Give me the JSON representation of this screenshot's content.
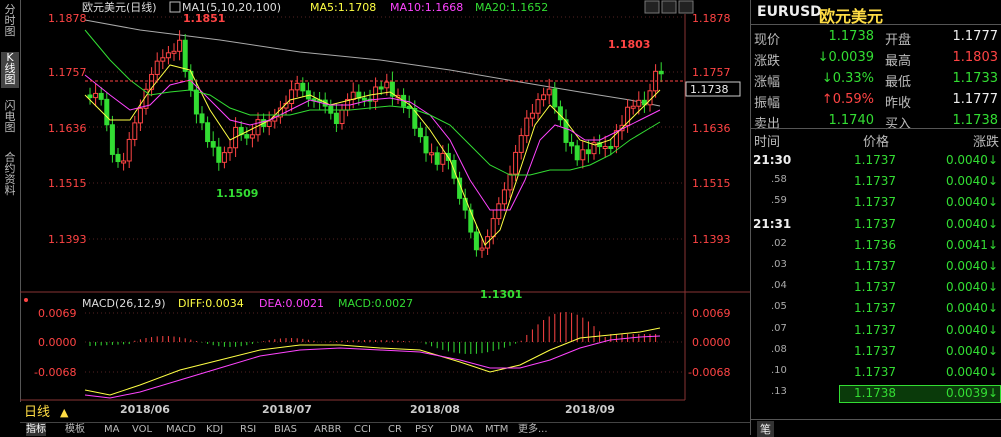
{
  "sidebar": {
    "items": [
      {
        "label": "分\n时\n图",
        "active": false
      },
      {
        "label": "K\n线\n图",
        "active": true
      },
      {
        "label": "闪\n电\n图",
        "active": false
      },
      {
        "label": "合\n约\n资\n料",
        "active": false
      }
    ]
  },
  "header": {
    "title": "欧元美元(日线)",
    "ma_label": "MA1(5,10,20,100)",
    "ma5": "MA5:1.1708",
    "ma10": "MA10:1.1668",
    "ma20": "MA20:1.1652",
    "nav_left": "◀",
    "nav_right": "▶"
  },
  "price_axis": {
    "ticks": [
      "1.1878",
      "1.1757",
      "1.1636",
      "1.1515",
      "1.1393"
    ],
    "current": "1.1738"
  },
  "annotations": {
    "high_left": "1.1851",
    "low_left": "1.1509",
    "low_mid": "1.1301",
    "high_right": "1.1803"
  },
  "macd": {
    "label": "MACD(26,12,9)",
    "diff": "DIFF:0.0034",
    "dea": "DEA:0.0021",
    "macd": "MACD:0.0027",
    "ticks": [
      "0.0069",
      "0.0000",
      "-0.0068"
    ]
  },
  "x_axis": {
    "labels": [
      "2018/06",
      "2018/07",
      "2018/08",
      "2018/09"
    ]
  },
  "period": {
    "label": "日线",
    "arrow": "▲"
  },
  "bottom_tabs": [
    "指标",
    "模板",
    "MA",
    "VOL",
    "MACD",
    "KDJ",
    "RSI",
    "BIAS",
    "ARBR",
    "CCI",
    "CR",
    "PSY",
    "DMA",
    "MTM",
    "更多..."
  ],
  "right_panel": {
    "symbol": "EURUSD",
    "name": "欧元美元",
    "quote": [
      {
        "l1": "现价",
        "v1": "1.1738",
        "c1": "#33dd33",
        "l2": "开盘",
        "v2": "1.1777",
        "c2": "#eeeeee"
      },
      {
        "l1": "涨跌",
        "v1": "↓0.0039",
        "c1": "#33dd33",
        "l2": "最高",
        "v2": "1.1803",
        "c2": "#ff4444"
      },
      {
        "l1": "涨幅",
        "v1": "↓0.33%",
        "c1": "#33dd33",
        "l2": "最低",
        "v2": "1.1733",
        "c2": "#33dd33"
      },
      {
        "l1": "振幅",
        "v1": "↑0.59%",
        "c1": "#ff4444",
        "l2": "昨收",
        "v2": "1.1777",
        "c2": "#eeeeee"
      },
      {
        "l1": "卖出",
        "v1": "1.1740",
        "c1": "#33dd33",
        "l2": "买入",
        "v2": "1.1738",
        "c2": "#33dd33"
      }
    ],
    "ticks_header": {
      "time": "时间",
      "price": "价格",
      "change": "涨跌"
    },
    "ticks": [
      {
        "time": "21:30",
        "price": "1.1737",
        "change": "0.0040↓",
        "major": true
      },
      {
        "time": ".58",
        "price": "1.1737",
        "change": "0.0040↓",
        "major": false
      },
      {
        "time": ".59",
        "price": "1.1737",
        "change": "0.0040↓",
        "major": false
      },
      {
        "time": "21:31",
        "price": "1.1737",
        "change": "0.0040↓",
        "major": true
      },
      {
        "time": ".02",
        "price": "1.1736",
        "change": "0.0041↓",
        "major": false
      },
      {
        "time": ".03",
        "price": "1.1737",
        "change": "0.0040↓",
        "major": false
      },
      {
        "time": ".04",
        "price": "1.1737",
        "change": "0.0040↓",
        "major": false
      },
      {
        "time": ".05",
        "price": "1.1737",
        "change": "0.0040↓",
        "major": false
      },
      {
        "time": ".07",
        "price": "1.1737",
        "change": "0.0040↓",
        "major": false
      },
      {
        "time": ".08",
        "price": "1.1737",
        "change": "0.0040↓",
        "major": false
      },
      {
        "time": ".10",
        "price": "1.1737",
        "change": "0.0040↓",
        "major": false
      },
      {
        "time": ".13",
        "price": "1.1738",
        "change": "0.0039↓",
        "major": false,
        "highlight": true
      }
    ],
    "bottom_tab": "笔"
  },
  "colors": {
    "up": "#ff4444",
    "down": "#33dd33",
    "ma5": "#ffff44",
    "ma10": "#ff44ff",
    "ma20": "#33dd33",
    "ma100": "#aaaaaa"
  }
}
